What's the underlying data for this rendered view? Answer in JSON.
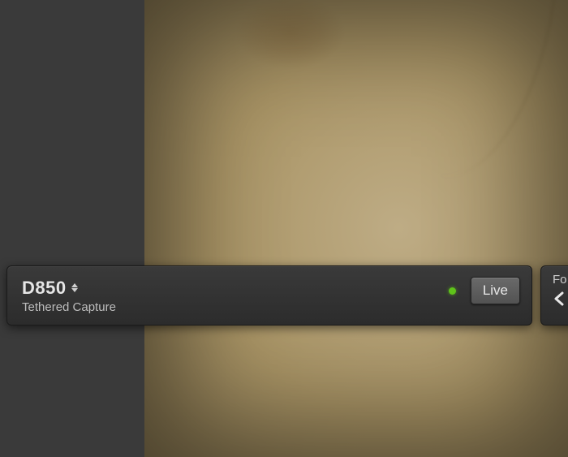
{
  "tether": {
    "camera_name": "D850",
    "mode_label": "Tethered Capture",
    "status_color": "#5fc31a",
    "live_button_label": "Live"
  },
  "panel2": {
    "label_fragment": "Fo"
  }
}
